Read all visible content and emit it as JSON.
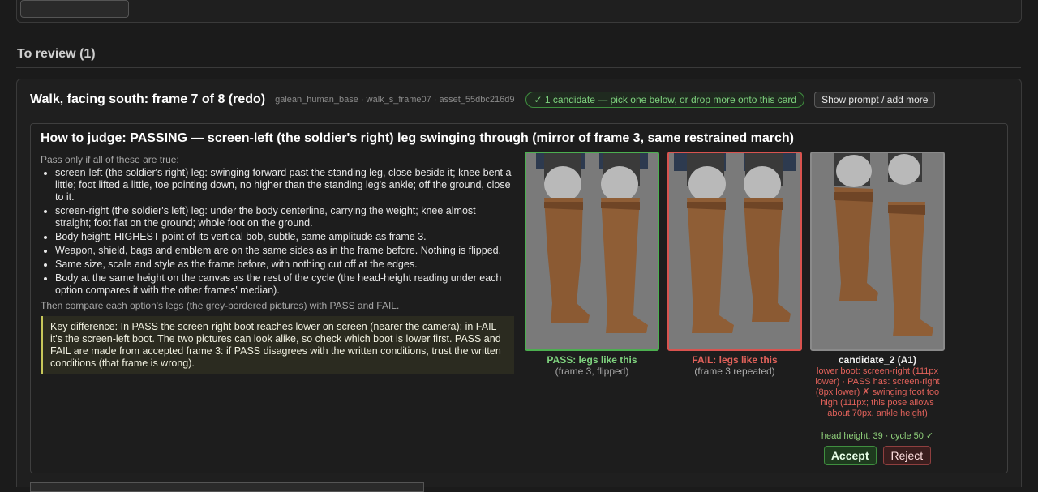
{
  "section": {
    "title": "To review (1)"
  },
  "card": {
    "title": "Walk, facing south: frame 7 of 8 (redo)",
    "meta": "galean_human_base · walk_s_frame07 · asset_55dbc216d9",
    "badge": "✓ 1 candidate — pick one below, or drop more onto this card",
    "prompt_button": "Show prompt / add more"
  },
  "judge": {
    "title": "How to judge: PASSING — screen-left (the soldier's right) leg swinging through (mirror of frame 3, same restrained march)",
    "intro": "Pass only if all of these are true:",
    "criteria": [
      "screen-left (the soldier's right) leg: swinging forward past the standing leg, close beside it; knee bent a little; foot lifted a little, toe pointing down, no higher than the standing leg's ankle; off the ground, close to it.",
      "screen-right (the soldier's left) leg: under the body centerline, carrying the weight; knee almost straight; foot flat on the ground; whole foot on the ground.",
      "Body height: HIGHEST point of its vertical bob, subtle, same amplitude as frame 3.",
      "Weapon, shield, bags and emblem are on the same sides as in the frame before. Nothing is flipped.",
      "Same size, scale and style as the frame before, with nothing cut off at the edges.",
      "Body at the same height on the canvas as the rest of the cycle (the head-height reading under each option compares it with the other frames' median)."
    ],
    "after": "Then compare each option's legs (the grey-bordered pictures) with PASS and FAIL.",
    "key_difference": "Key difference: In PASS the screen-right boot reaches lower on screen (nearer the camera); in FAIL it's the screen-left boot. The two pictures can look alike, so check which boot is lower first. PASS and FAIL are made from accepted frame 3: if PASS disagrees with the written conditions, trust the written conditions (that frame is wrong)."
  },
  "options": {
    "pass": {
      "label": "PASS: legs like this",
      "sub": "(frame 3, flipped)",
      "color": "#4caf50"
    },
    "fail": {
      "label": "FAIL: legs like this",
      "sub": "(frame 3 repeated)",
      "color": "#d9534f"
    },
    "candidate": {
      "label": "candidate_2 (A1)",
      "note": "lower boot: screen-right (111px lower) · PASS has: screen-right (8px lower) ✗ swinging foot too high (111px; this pose allows about 70px, ankle height)",
      "head_height": "head height: 39 · cycle 50 ✓",
      "accept_label": "Accept",
      "reject_label": "Reject"
    }
  },
  "colors": {
    "accent_green": "#4caf50",
    "accent_red": "#d9534f",
    "key_bar": "#c8c85a"
  },
  "icons": [
    "check-icon",
    "boot-legs-image"
  ]
}
